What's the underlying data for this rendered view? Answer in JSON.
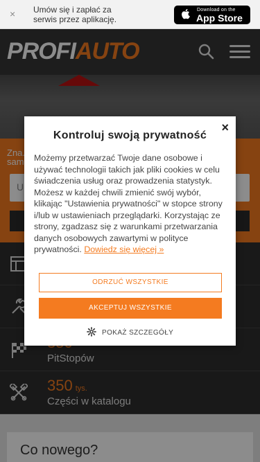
{
  "app_banner": {
    "close_label": "×",
    "text": "Umów się i zapłać za serwis przez aplikację.",
    "store_small": "Download on the",
    "store_big": "App Store"
  },
  "header": {
    "logo_part1": "PROFI",
    "logo_part2": "AUTO"
  },
  "band": {
    "lead_text": "Zna...\nsam...",
    "input_text": "U"
  },
  "stats": [
    {
      "number": "",
      "unit": "",
      "label": ""
    },
    {
      "number": "",
      "unit": "",
      "label": ""
    },
    {
      "number": "350",
      "unit": "",
      "label": "PitStopów"
    },
    {
      "number": "350",
      "unit": "tys.",
      "label": "Części w katalogu"
    }
  ],
  "card": {
    "heading": "Co nowego?"
  },
  "modal": {
    "close_label": "×",
    "title": "Kontroluj swoją prywatność",
    "body_text": "Możemy przetwarzać Twoje dane osobowe i używać technologii takich jak pliki cookies w celu świadczenia usług oraz prowadzenia statystyk. Możesz w każdej chwili zmienić swój wybór, klikając \"Ustawienia prywatności\" w stopce strony i/lub w ustawieniach przeglądarki. Korzystając ze strony, zgadzasz się z warunkami przetwarzania danych osobowych zawartymi w polityce prywatności.",
    "link_text": "Dowiedz się więcej »",
    "reject_label": "ODRZUĆ WSZYSTKIE",
    "accept_label": "AKCEPTUJ WSZYSTKIE",
    "details_label": "POKAŻ SZCZEGÓŁY"
  },
  "colors": {
    "accent": "#f47b20",
    "dark": "#2f2f2f"
  }
}
